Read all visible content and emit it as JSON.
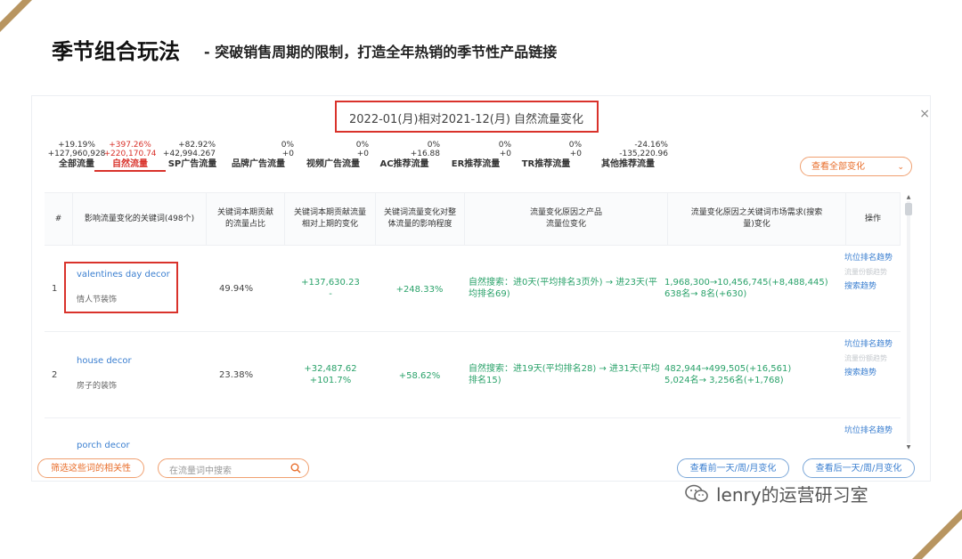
{
  "slide": {
    "title": "季节组合玩法",
    "subtitle": "- 突破销售周期的限制，打造全年热销的季节性产品链接",
    "watermark": "lenry的运营研习室"
  },
  "panel": {
    "header": "2022-01(月)相对2021-12(月) 自然流量变化",
    "close": "×",
    "view_all": "查看全部变化",
    "stats": [
      {
        "pct": "+19.19%",
        "abs": "+127,960,928",
        "label": "全部流量"
      },
      {
        "pct": "+397.26%",
        "abs": "+220,170.74",
        "label": "自然流量"
      },
      {
        "pct": "+82.92%",
        "abs": "+42,994.267",
        "label": "SP广告流量"
      },
      {
        "pct": "0%",
        "abs": "+0",
        "label": "品牌广告流量"
      },
      {
        "pct": "0%",
        "abs": "+0",
        "label": "视频广告流量"
      },
      {
        "pct": "0%",
        "abs": "+16.88",
        "label": "AC推荐流量"
      },
      {
        "pct": "0%",
        "abs": "+0",
        "label": "ER推荐流量"
      },
      {
        "pct": "0%",
        "abs": "+0",
        "label": "TR推荐流量"
      },
      {
        "pct": "-24.16%",
        "abs": "-135,220.96",
        "label": "其他推荐流量"
      }
    ],
    "columns": {
      "index": "#",
      "keyword": "影响流量变化的关键词(498个)",
      "share": "关键词本期贡献的流量占比",
      "contrib": "关键词本期贡献流量相对上期的变化",
      "impact": "关键词流量变化对整体流量的影响程度",
      "reason_rank": "流量变化原因之产品流量位变化",
      "reason_demand": "流量变化原因之关键词市场需求(搜索量)变化",
      "ops": "操作"
    },
    "rows": [
      {
        "idx": "1",
        "kw_en": "valentines day decor",
        "kw_cn": "情人节装饰",
        "share": "49.94%",
        "contrib_a": "+137,630.23",
        "contrib_b": "-",
        "impact": "+248.33%",
        "rank_change": "自然搜索：进0天(平均排名3页外) → 进23天(平均排名69)",
        "demand_a": "1,968,300→10,456,745(+8,488,445)",
        "demand_b": "638名→ 8名(+630)",
        "op1": "坑位排名趋势",
        "op2": "流量份额趋势",
        "op3": "搜索趋势"
      },
      {
        "idx": "2",
        "kw_en": "house decor",
        "kw_cn": "房子的装饰",
        "share": "23.38%",
        "contrib_a": "+32,487.62",
        "contrib_b": "+101.7%",
        "impact": "+58.62%",
        "rank_change": "自然搜索：进19天(平均排名28) → 进31天(平均排名15)",
        "demand_a": "482,944→499,505(+16,561)",
        "demand_b": "5,024名→ 3,256名(+1,768)",
        "op1": "坑位排名趋势",
        "op2": "流量份额趋势",
        "op3": "搜索趋势"
      },
      {
        "idx": "",
        "kw_en": "porch decor",
        "kw_cn": "",
        "share": "",
        "contrib_a": "",
        "contrib_b": "",
        "impact": "",
        "rank_change": "",
        "demand_a": "",
        "demand_b": "",
        "op1": "坑位排名趋势",
        "op2": "",
        "op3": ""
      }
    ],
    "footer": {
      "filter_button": "筛选这些词的相关性",
      "search_placeholder": "在流量词中搜索",
      "prev_button": "查看前一天/周/月变化",
      "next_button": "查看后一天/周/月变化"
    }
  },
  "colors": {
    "accent": "#d9322b",
    "orange": "#e86d2a",
    "link": "#3b7fd0",
    "green": "#2aa26a",
    "gold": "#b89560"
  }
}
